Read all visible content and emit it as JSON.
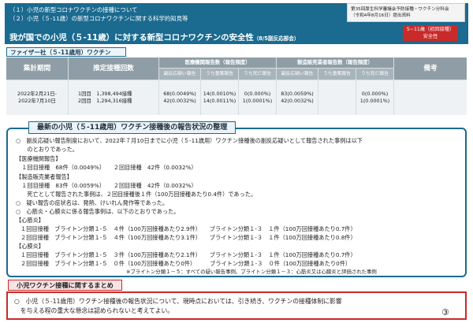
{
  "header": {
    "line1": "（１）小児の新型コロナワクチンの接種について",
    "line2": "（２）小児（５-11歳）の新型コロナワクチンに関する科学的知見等",
    "meeting_line1": "第35回厚生科学審議会予防接種・ワクチン分科会",
    "meeting_line2": "（令和4年8月16日）提出資料",
    "title": "我が国での小児（５-11歳）に対する新型コロナワクチンの安全性",
    "title_small": "（8/5副反応部会）",
    "age_tag_line1": "5~11歳（初回接種）",
    "age_tag_line2": "安全性"
  },
  "vaccine_label": "ファイザー社（５-11歳用）ワクチン",
  "table": {
    "col_period": "集計期間",
    "col_doses": "推定接種回数",
    "grp_medical": "医療機関報告数（報告頻度）",
    "grp_maker": "製造販売業者報告数（報告頻度）",
    "col_notes": "備考",
    "sub_adverse": "副反応疑い報告",
    "sub_serious": "うち重篤報告",
    "sub_death": "うち死亡報告",
    "period_line1": "2022年2月21日-",
    "period_line2": "2022年7月10日",
    "rows": [
      {
        "dose": "1回目",
        "count": "1,398,494接種",
        "med_adverse": "68(0.0049%)",
        "med_serious": "14(0.0010%)",
        "med_death": "0(0.000%)",
        "mk_adverse": "83(0.0059%)",
        "mk_death": "0(0.000%)"
      },
      {
        "dose": "2回目",
        "count": "1,294,316接種",
        "med_adverse": "42(0.0032%)",
        "med_serious": "14(0.0011%)",
        "med_death": "1(0.0001%)",
        "mk_adverse": "42(0.0032%)",
        "mk_death": "1(0.0001%)"
      }
    ]
  },
  "summary_box": {
    "title": "最新の小児（５-11歳用）ワクチン接種後の報告状況の整理",
    "lines": [
      "○　副反応疑い報告制度において、2022年７月10日までに小児（５-11歳用）ワクチン接種後の副反応疑いとして報告された事例は以下",
      "　　のとおりであった。",
      "【医療機関報告】",
      "　１回目接種　68件（0.0049%）　　２回目接種　42件（0.0032%）",
      "【製造販売業者報告】",
      "　１回目接種　83件（0.0059%）　　２回目接種　42件（0.0032%）",
      "　　死亡として報告された事例は、２回目接種後１件（100万回接種あたり0.4件）であった。",
      "○　疑い報告の症状名は、発熱、けいれん発作等であった。",
      "○　心筋炎・心膜炎に係る報告事例は、以下のとおりであった。",
      "【心筋炎】",
      "１回目接種　ブライトン分類１-５　４件（100万回接種あたり2.9件）　　ブライトン分類１-３　１件（100万回接種あたり0.7件）",
      "２回目接種　ブライトン分類１-５　４件（100万回接種あたり3.1件）　　ブライトン分類１-３　１件（100万回接種あたり0.8件）",
      "【心膜炎】",
      "１回目接種　ブライトン分類１-５　３件（100万回接種あたり2.1件）　　ブライトン分類１-３　１件（100万回接種あたり0.7件）",
      "２回目接種　ブライトン分類１-５　０件（100万回接種あたり0件）　　　ブライトン分類１-３　０件（100万回接種あたり0件）"
    ],
    "footnote": "※ブライトン分類１－５：すべての疑い報告事例、ブライトン分類１－３：心筋炎又は心膜炎と評価された事例"
  },
  "conclusion": {
    "title": "小児ワクチン接種に関するまとめ",
    "line1": "○　小児（５-11歳用）ワクチン接種後の報告状況について、現時点においては、引き続き、ワクチンの接種体制に影響",
    "line2": "　を与える程の重大な懸念は認められないと考えてよい。",
    "page": "③"
  }
}
